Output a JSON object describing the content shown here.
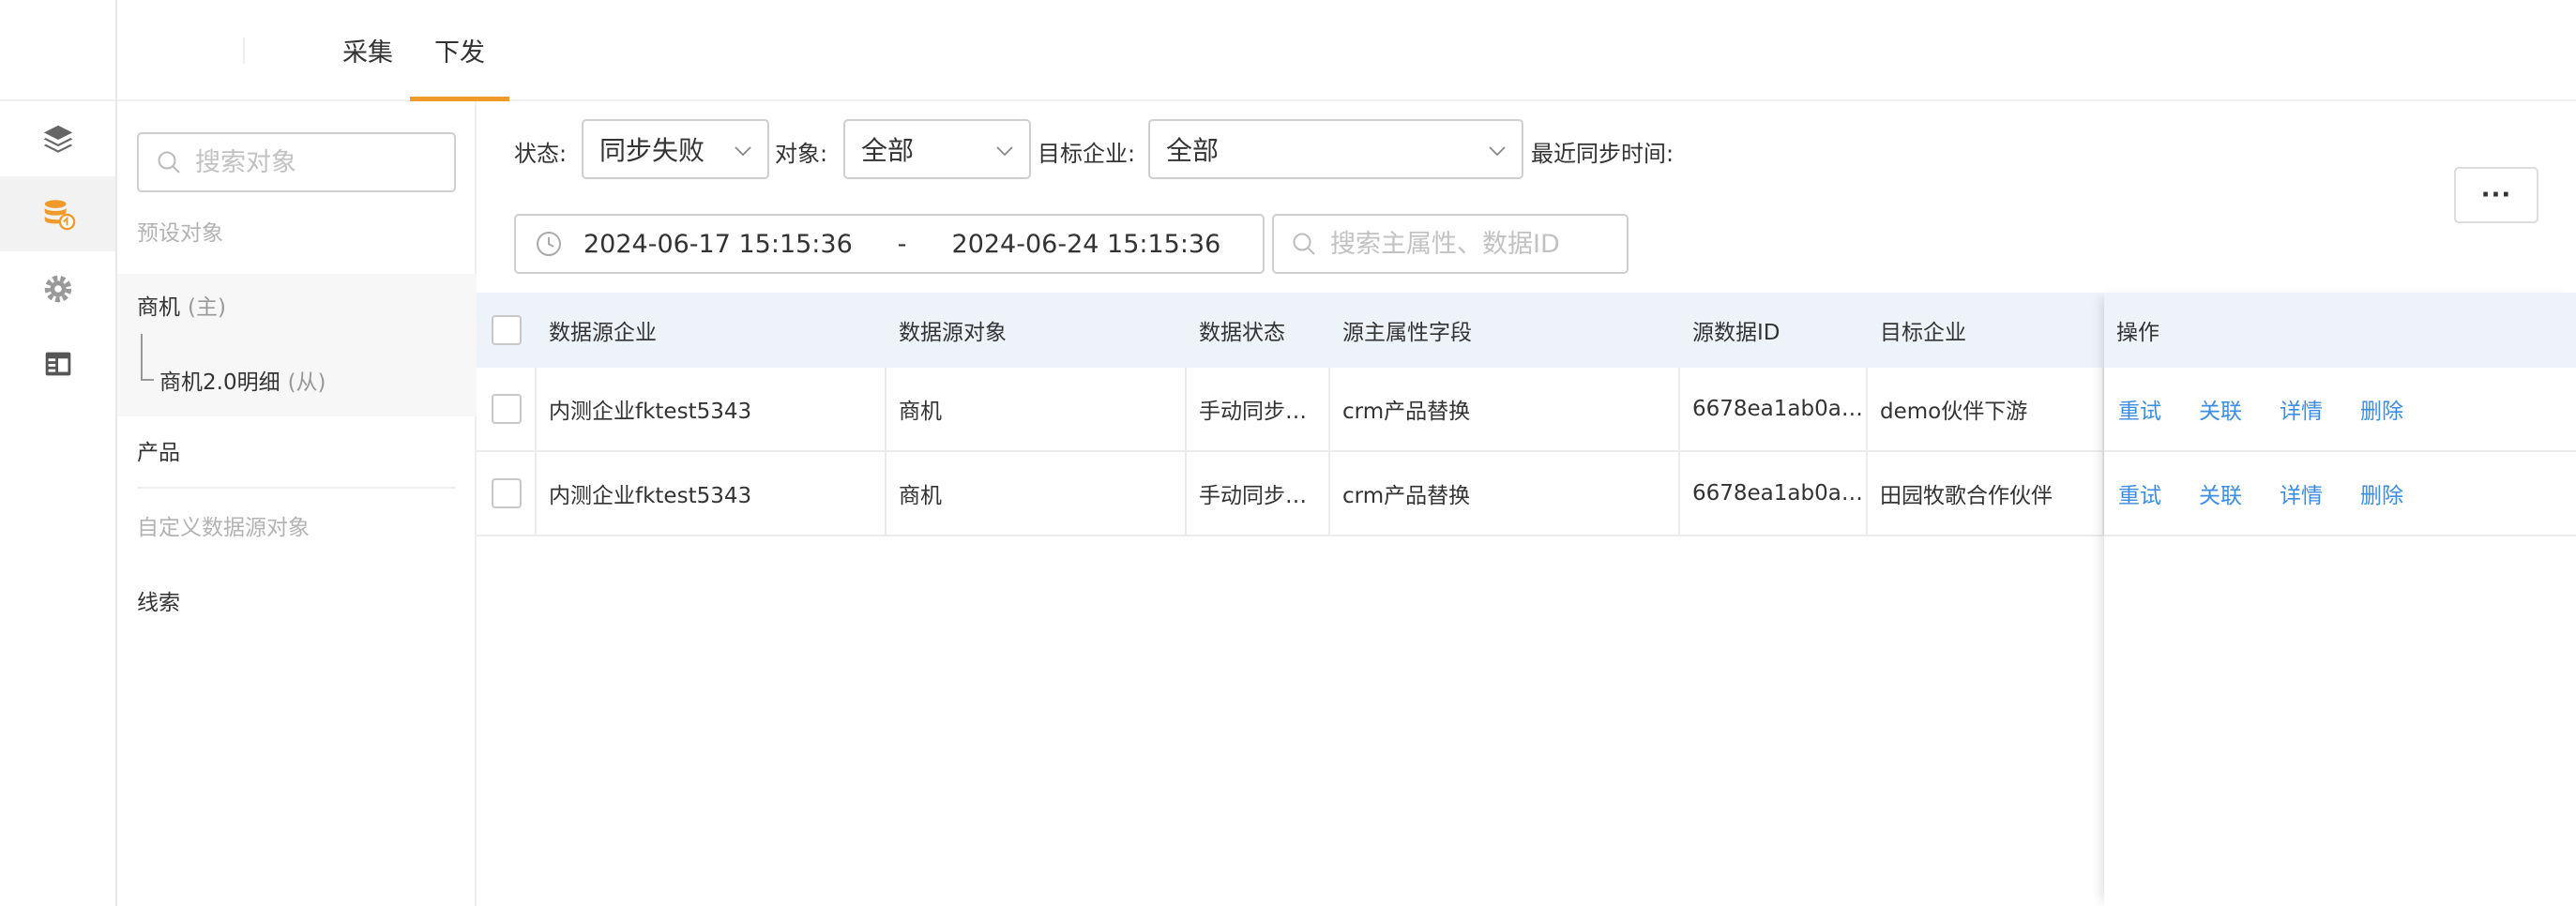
{
  "rail": {
    "items": [
      {
        "icon": "layers-icon",
        "active": false
      },
      {
        "icon": "database-sync-icon",
        "active": true
      },
      {
        "icon": "gear-icon",
        "active": false
      },
      {
        "icon": "table-icon",
        "active": false
      }
    ]
  },
  "tabs": [
    {
      "label": "采集",
      "active": false
    },
    {
      "label": "下发",
      "active": true
    }
  ],
  "object_panel": {
    "search_placeholder": "搜索对象",
    "preset_title": "预设对象",
    "preset_items": [
      {
        "label": "商机",
        "tag": "(主)"
      },
      {
        "label": "商机2.0明细",
        "tag": "(从)"
      },
      {
        "label": "产品"
      }
    ],
    "custom_title": "自定义数据源对象",
    "custom_items": [
      {
        "label": "线索"
      }
    ]
  },
  "filters": {
    "status_label": "状态:",
    "status_value": "同步失败",
    "object_label": "对象:",
    "object_value": "全部",
    "target_label": "目标企业:",
    "target_value": "全部",
    "recent_label": "最近同步时间:",
    "date_start": "2024-06-17 15:15:36",
    "date_sep": "-",
    "date_end": "2024-06-24 15:15:36",
    "data_search_placeholder": "搜索主属性、数据ID",
    "more_label": "···"
  },
  "table": {
    "columns": [
      "数据源企业",
      "数据源对象",
      "数据状态",
      "源主属性字段",
      "源数据ID",
      "目标企业",
      "操作"
    ],
    "rows": [
      [
        "内测企业fktest5343",
        "商机",
        "手动同步…",
        "crm产品替换",
        "6678ea1ab0a…",
        "demo伙伴下游"
      ],
      [
        "内测企业fktest5343",
        "商机",
        "手动同步…",
        "crm产品替换",
        "6678ea1ab0a…",
        "田园牧歌合作伙伴"
      ]
    ],
    "actions": [
      "重试",
      "关联",
      "详情",
      "删除"
    ]
  },
  "colors": {
    "accent": "#f09a2a",
    "link": "#3a8ee6",
    "header_bg": "#eef3fa"
  }
}
